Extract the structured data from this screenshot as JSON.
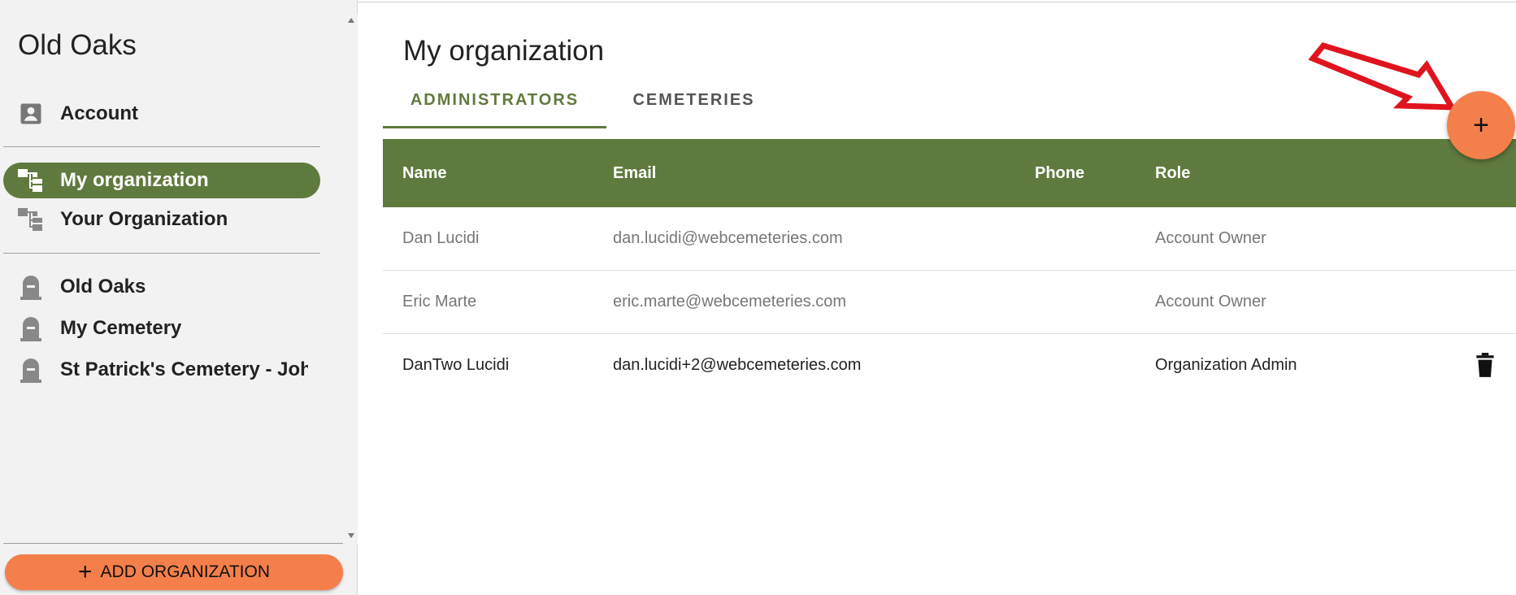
{
  "sidebar": {
    "org_title": "Old Oaks",
    "account_label": "Account",
    "org_items": [
      {
        "label": "My organization",
        "active": true
      },
      {
        "label": "Your Organization",
        "active": false
      }
    ],
    "cemeteries": [
      {
        "label": "Old Oaks"
      },
      {
        "label": "My Cemetery"
      },
      {
        "label": "St Patrick's Cemetery - Joh"
      }
    ],
    "add_org_label": "ADD ORGANIZATION"
  },
  "main": {
    "title": "My organization",
    "tabs": [
      {
        "label": "ADMINISTRATORS",
        "active": true
      },
      {
        "label": "CEMETERIES",
        "active": false
      }
    ],
    "table": {
      "headers": [
        "Name",
        "Email",
        "Phone",
        "Role"
      ],
      "rows": [
        {
          "name": "Dan Lucidi",
          "email": "dan.lucidi@webcemeteries.com",
          "phone": "",
          "role": "Account Owner"
        },
        {
          "name": "Eric Marte",
          "email": "eric.marte@webcemeteries.com",
          "phone": "",
          "role": "Account Owner"
        },
        {
          "name": "DanTwo Lucidi",
          "email": "dan.lucidi+2@webcemeteries.com",
          "phone": "",
          "role": "Organization Admin"
        }
      ]
    },
    "fab_label": "+"
  },
  "colors": {
    "accent_green": "#5f7a3e",
    "accent_orange": "#f47f4b",
    "annotation_red": "#e0141e"
  }
}
